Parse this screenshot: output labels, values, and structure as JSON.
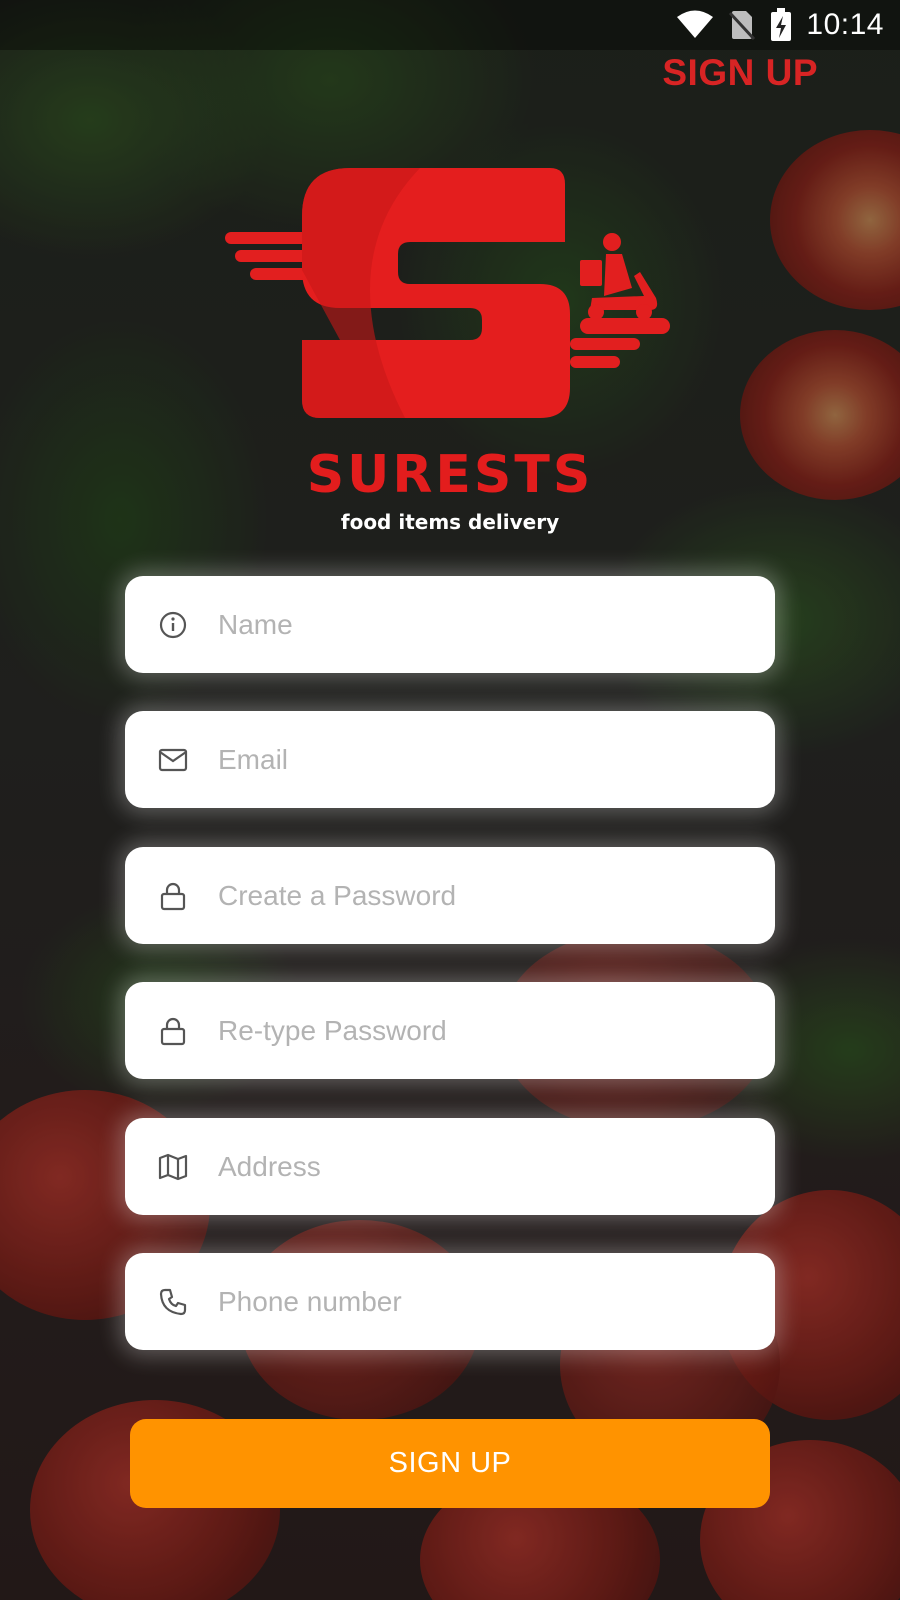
{
  "status_bar": {
    "time": "10:14",
    "icons": [
      "wifi-icon",
      "no-sim-icon",
      "battery-charging-icon"
    ]
  },
  "header": {
    "signup_link": "SIGN UP"
  },
  "brand": {
    "name": "SURESTS",
    "tagline": "food items delivery",
    "color": "#e31d1d"
  },
  "form": {
    "fields": [
      {
        "icon": "info-icon",
        "placeholder": "Name",
        "value": ""
      },
      {
        "icon": "mail-icon",
        "placeholder": "Email",
        "value": ""
      },
      {
        "icon": "lock-icon",
        "placeholder": "Create a Password",
        "value": ""
      },
      {
        "icon": "lock-icon",
        "placeholder": "Re-type Password",
        "value": ""
      },
      {
        "icon": "map-icon",
        "placeholder": "Address",
        "value": ""
      },
      {
        "icon": "phone-icon",
        "placeholder": "Phone number",
        "value": ""
      }
    ],
    "submit_label": "SIGN UP",
    "submit_color": "#ff9300"
  }
}
